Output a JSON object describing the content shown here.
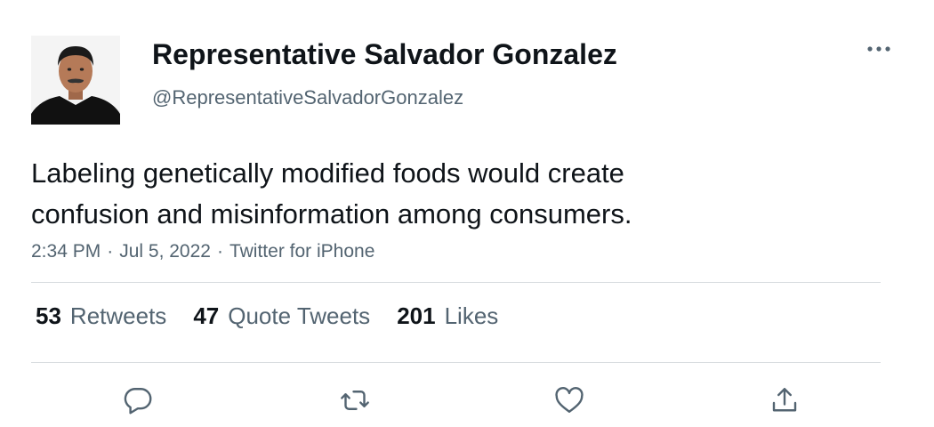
{
  "author": {
    "name": "Representative Salvador Gonzalez",
    "handle": "@RepresentativeSalvadorGonzalez"
  },
  "tweet": {
    "lines": [
      "Labeling genetically modified foods would create",
      "confusion and misinformation among consumers."
    ],
    "time": "2:34 PM",
    "date": "Jul 5, 2022",
    "source": "Twitter for iPhone",
    "separator": "·"
  },
  "stats": {
    "retweets": {
      "count": "53",
      "label": "Retweets"
    },
    "quotes": {
      "count": "47",
      "label": "Quote Tweets"
    },
    "likes": {
      "count": "201",
      "label": "Likes"
    }
  },
  "icons": {
    "more": "more-dots-icon",
    "reply": "reply-icon",
    "retweet": "retweet-icon",
    "like": "like-icon",
    "share": "share-icon"
  },
  "colors": {
    "text": "#0f1419",
    "secondary": "#536471",
    "divider": "#d9dde0"
  }
}
